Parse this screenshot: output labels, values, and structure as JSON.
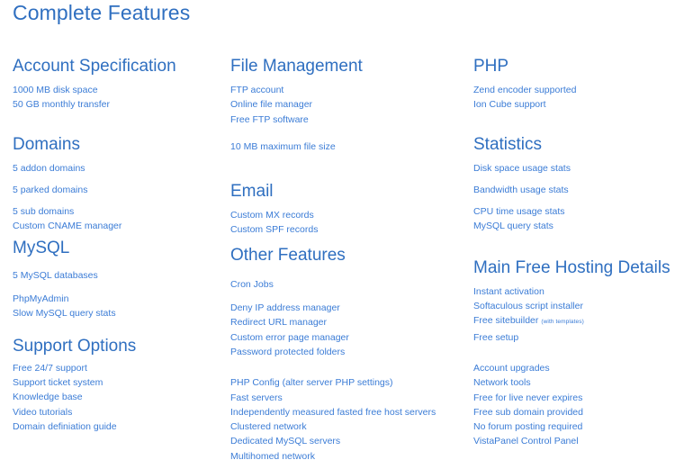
{
  "page": {
    "title": "Complete Features",
    "colors": {
      "heading": "#2f6fc0",
      "body_text": "#3b7cd6",
      "background": "#ffffff"
    }
  },
  "columns": [
    {
      "id": "left",
      "sections": [
        {
          "heading": "Account Specification",
          "groups": [
            {
              "items": [
                "1000 MB disk space",
                "50 GB monthly transfer"
              ]
            }
          ]
        },
        {
          "heading": "Domains",
          "groups": [
            {
              "items": [
                "5 addon domains"
              ]
            },
            {
              "items": [
                "5 parked domains"
              ]
            },
            {
              "items": [
                "5 sub domains",
                "Custom CNAME manager"
              ]
            }
          ]
        },
        {
          "heading": "MySQL",
          "groups": [
            {
              "items": [
                "5 MySQL databases"
              ]
            },
            {
              "items": [
                "PhpMyAdmin",
                "Slow MySQL query stats"
              ]
            }
          ]
        },
        {
          "heading": "Support Options",
          "groups": [
            {
              "items": [
                "Free 24/7 support",
                "Support ticket system",
                "Knowledge base",
                "Video tutorials",
                "Domain definiation guide"
              ]
            }
          ]
        }
      ]
    },
    {
      "id": "middle",
      "sections": [
        {
          "heading": "File Management",
          "groups": [
            {
              "items": [
                "FTP account",
                "Online file manager",
                "Free FTP software"
              ]
            },
            {
              "items": [
                "10 MB maximum file size"
              ]
            }
          ]
        },
        {
          "heading": "Email",
          "groups": [
            {
              "items": [
                "Custom MX records",
                "Custom SPF records"
              ]
            }
          ]
        },
        {
          "heading": "Other Features",
          "groups": [
            {
              "items": [
                "Cron Jobs"
              ]
            },
            {
              "items": [
                "Deny IP address manager",
                "Redirect URL manager",
                "Custom error page manager",
                "Password protected folders"
              ]
            },
            {
              "items": [
                "PHP Config (alter server PHP settings)",
                "Fast servers",
                "Independently measured fasted free host servers",
                "Clustered network",
                "Dedicated MySQL servers",
                "Multihomed network"
              ]
            }
          ]
        }
      ]
    },
    {
      "id": "right",
      "sections": [
        {
          "heading": "PHP",
          "groups": [
            {
              "items": [
                "Zend encoder supported",
                "Ion Cube support"
              ]
            }
          ]
        },
        {
          "heading": "Statistics",
          "groups": [
            {
              "items": [
                "Disk space usage stats"
              ]
            },
            {
              "items": [
                "Bandwidth usage stats"
              ]
            },
            {
              "items": [
                "CPU time usage stats",
                "MySQL query stats"
              ]
            }
          ]
        },
        {
          "heading": "Main Free Hosting Details",
          "groups": [
            {
              "items": [
                "Instant activation",
                "Softaculous script installer",
                "Free sitebuilder",
                "Free setup"
              ],
              "notes": {
                "2": "(with templates)"
              }
            },
            {
              "items": [
                "Account upgrades",
                "Network tools",
                "Free for live never expires",
                "Free sub domain provided",
                "No forum posting required",
                "VistaPanel Control Panel"
              ]
            }
          ]
        }
      ]
    }
  ]
}
